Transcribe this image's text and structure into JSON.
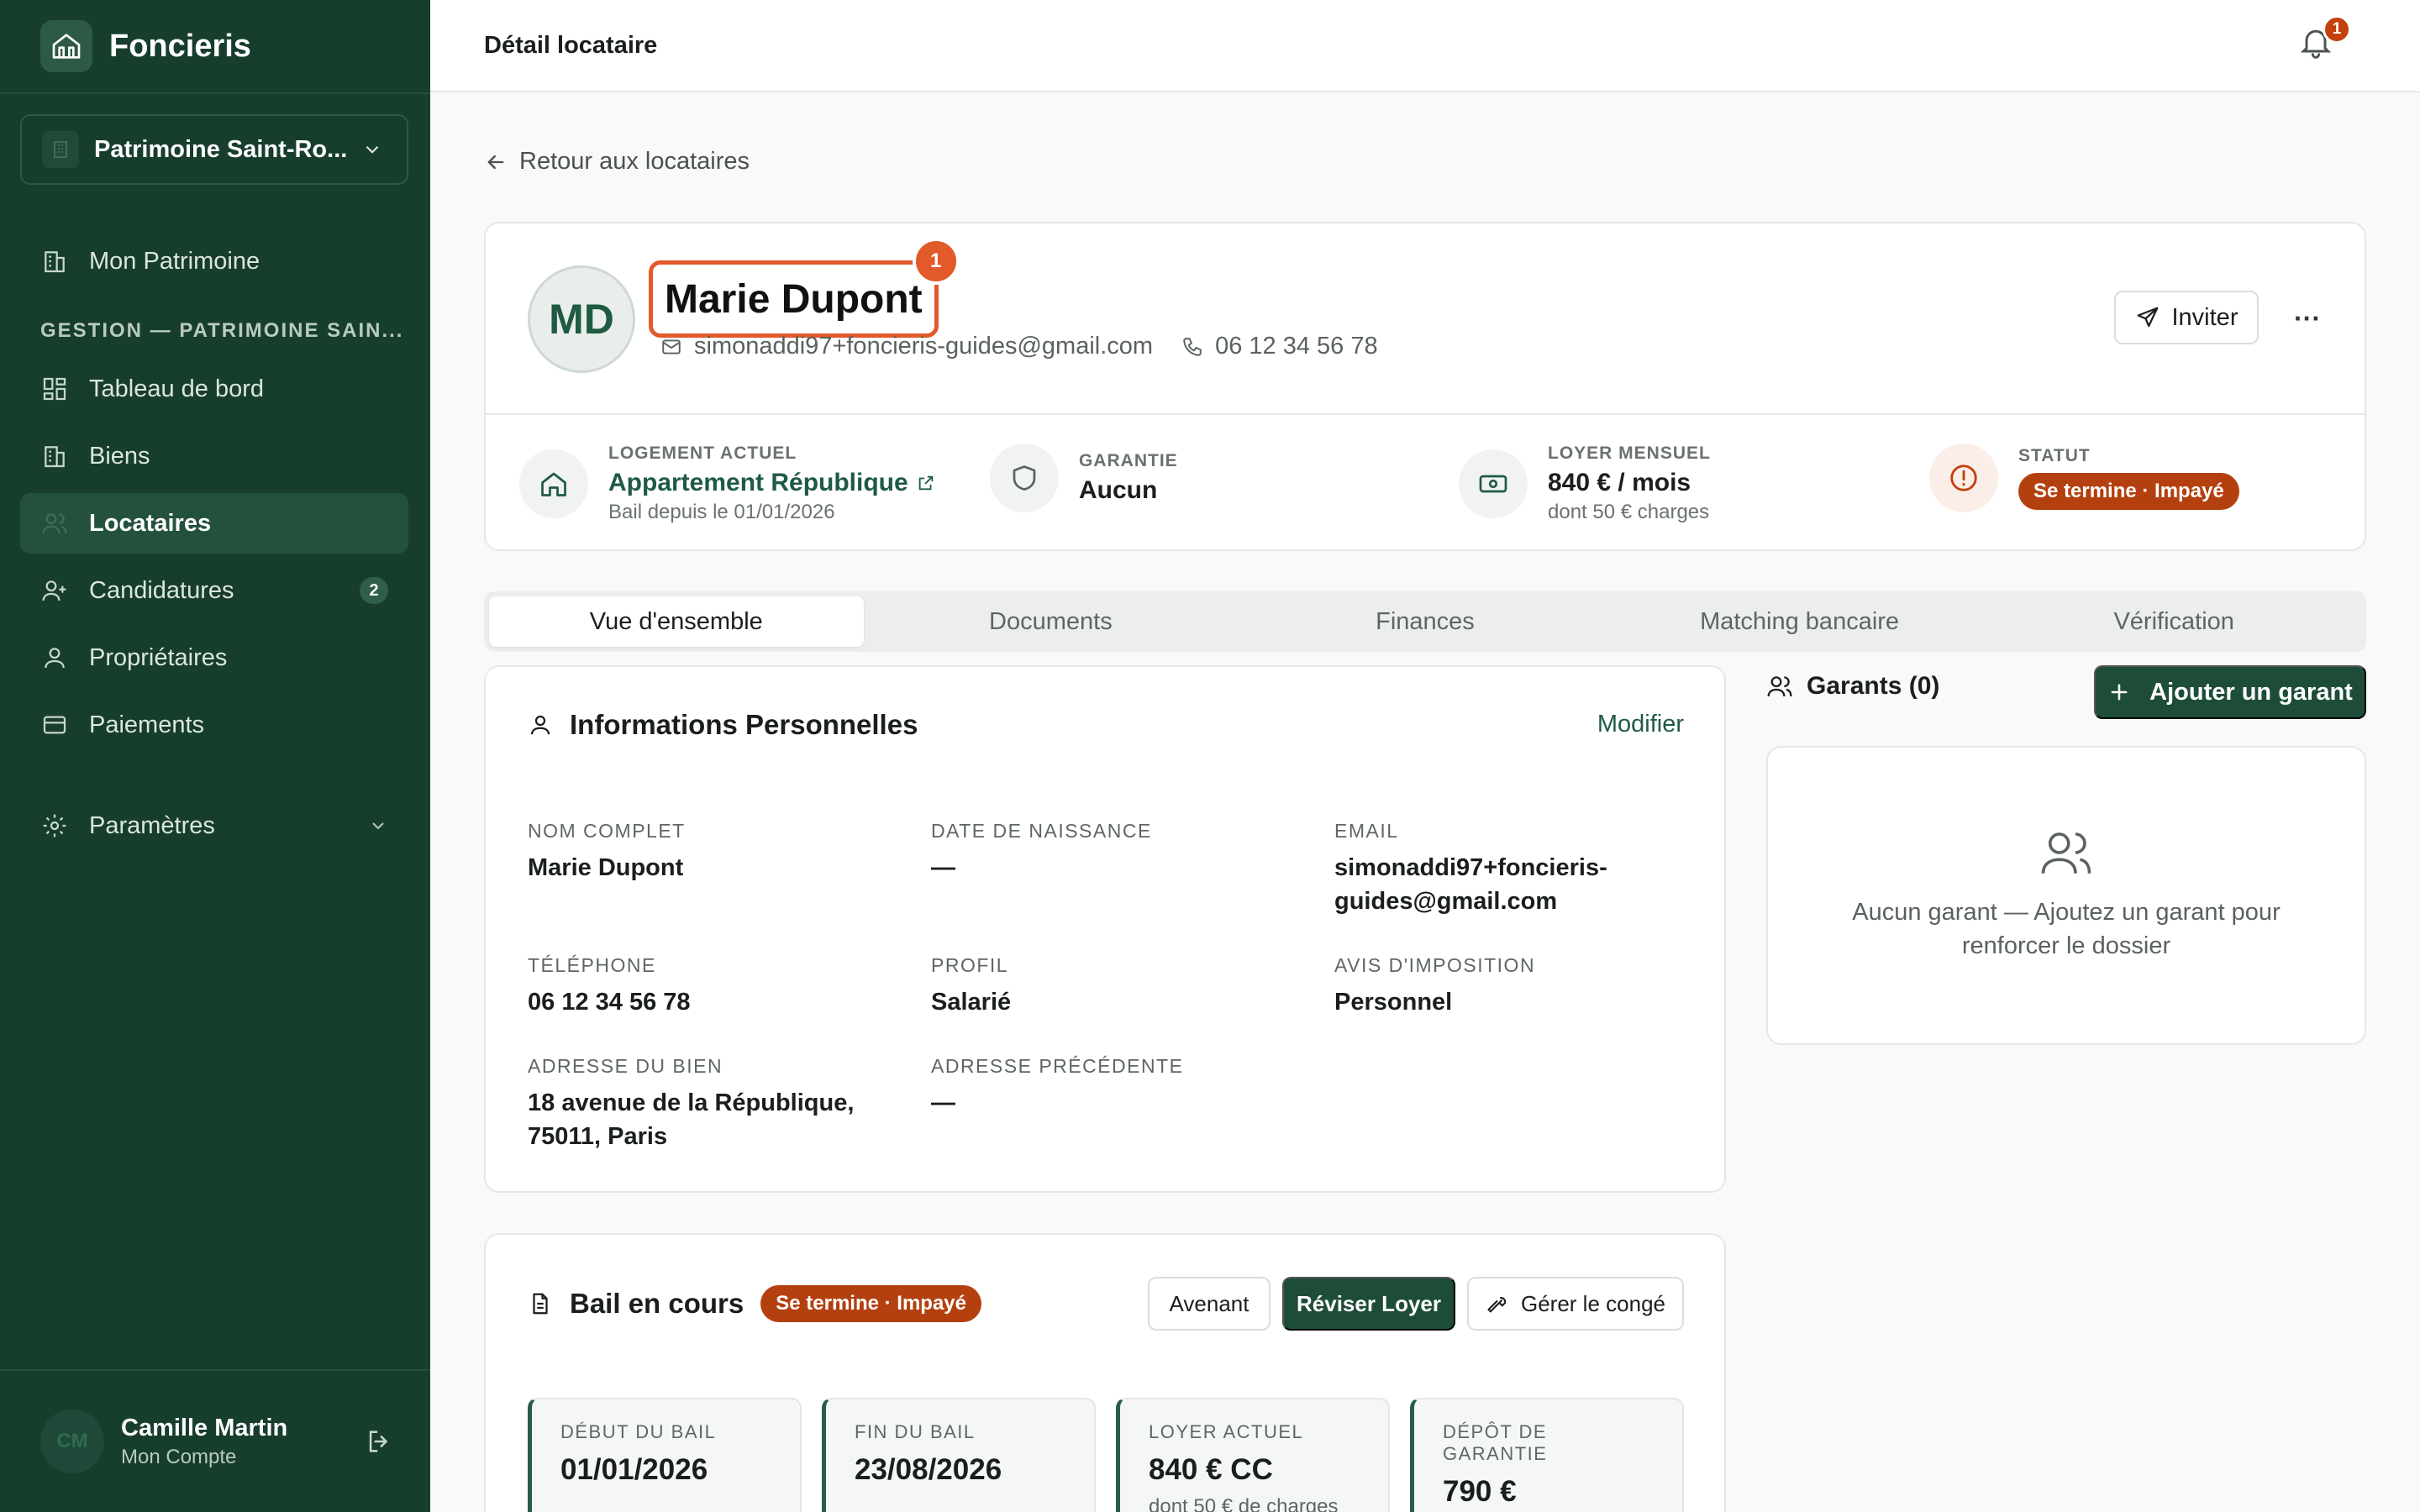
{
  "app": {
    "name": "Foncieris"
  },
  "sidebar": {
    "workspace": "Patrimoine Saint-Ro...",
    "top_item": "Mon Patrimoine",
    "section_label": "GESTION — PATRIMOINE SAIN...",
    "items": [
      {
        "label": "Tableau de bord",
        "icon": "dashboard-icon"
      },
      {
        "label": "Biens",
        "icon": "building-icon"
      },
      {
        "label": "Locataires",
        "icon": "users-icon",
        "active": true
      },
      {
        "label": "Candidatures",
        "icon": "user-plus-icon",
        "badge": "2"
      },
      {
        "label": "Propriétaires",
        "icon": "user-icon"
      },
      {
        "label": "Paiements",
        "icon": "card-icon"
      }
    ],
    "settings": "Paramètres",
    "user": {
      "initials": "CM",
      "name": "Camille Martin",
      "subtitle": "Mon Compte"
    }
  },
  "header": {
    "title": "Détail locataire",
    "notifications": "1"
  },
  "back_link": "Retour aux locataires",
  "tenant": {
    "initials": "MD",
    "name": "Marie Dupont",
    "annotation_badge": "1",
    "email": "simonaddi97+foncieris-guides@gmail.com",
    "phone": "06 12 34 56 78",
    "invite_label": "Inviter",
    "more_label": "···"
  },
  "stats": {
    "housing": {
      "label": "LOGEMENT ACTUEL",
      "value": "Appartement République",
      "sub": "Bail depuis le 01/01/2026"
    },
    "guarantee": {
      "label": "GARANTIE",
      "value": "Aucun"
    },
    "rent": {
      "label": "LOYER MENSUEL",
      "value": "840 € / mois",
      "sub": "dont 50 € charges"
    },
    "status": {
      "label": "STATUT",
      "value": "Se termine · Impayé"
    }
  },
  "tabs": [
    "Vue d'ensemble",
    "Documents",
    "Finances",
    "Matching bancaire",
    "Vérification"
  ],
  "personal_info": {
    "title": "Informations Personnelles",
    "edit_label": "Modifier",
    "fields": {
      "full_name": {
        "label": "NOM COMPLET",
        "value": "Marie Dupont"
      },
      "birth_date": {
        "label": "DATE DE NAISSANCE",
        "value": "—"
      },
      "email": {
        "label": "EMAIL",
        "value": "simonaddi97+foncieris-guides@gmail.com"
      },
      "phone": {
        "label": "TÉLÉPHONE",
        "value": "06 12 34 56 78"
      },
      "profile": {
        "label": "PROFIL",
        "value": "Salarié"
      },
      "tax_notice": {
        "label": "AVIS D'IMPOSITION",
        "value": "Personnel"
      },
      "property_address": {
        "label": "ADRESSE DU BIEN",
        "value": "18 avenue de la République, 75011, Paris"
      },
      "previous_address": {
        "label": "ADRESSE PRÉCÉDENTE",
        "value": "—"
      }
    }
  },
  "guarantors": {
    "title": "Garants (0)",
    "add_label": "Ajouter un garant",
    "empty_text": "Aucun garant — Ajoutez un garant pour renforcer le dossier"
  },
  "lease": {
    "title": "Bail en cours",
    "status": "Se termine · Impayé",
    "buttons": {
      "amendment": "Avenant",
      "revise": "Réviser Loyer",
      "notice": "Gérer le congé"
    },
    "tiles": [
      {
        "label": "DÉBUT DU BAIL",
        "value": "01/01/2026",
        "sub": ""
      },
      {
        "label": "FIN DU BAIL",
        "value": "23/08/2026",
        "sub": ""
      },
      {
        "label": "LOYER ACTUEL",
        "value": "840 € CC",
        "sub": "dont 50 € de charges"
      },
      {
        "label": "DÉPÔT DE GARANTIE",
        "value": "790 €",
        "sub": ""
      }
    ]
  },
  "colors": {
    "sidebar": "#173d2d",
    "accent": "#1d4d38",
    "status": "#b4400f",
    "annotation": "#e2592a"
  }
}
